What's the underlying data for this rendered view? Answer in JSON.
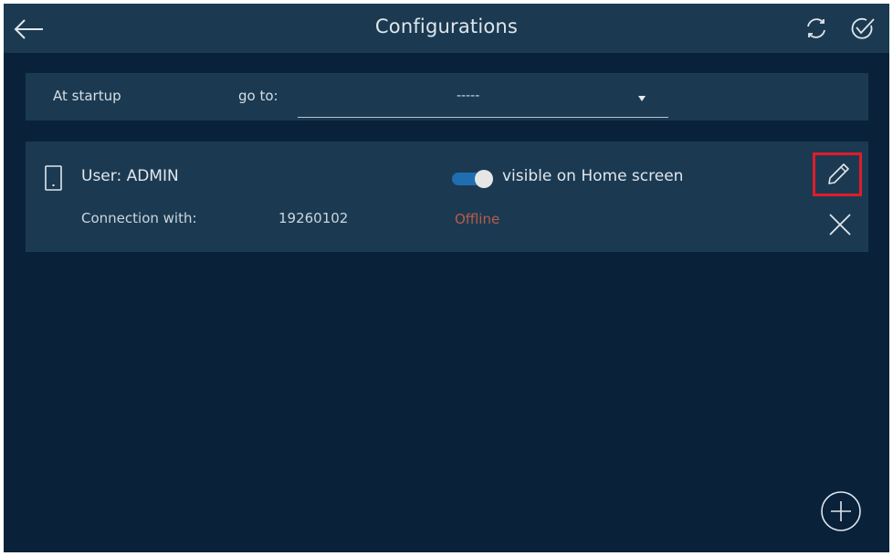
{
  "header": {
    "title": "Configurations",
    "back_icon": "arrow-left-icon",
    "refresh_icon": "refresh-icon",
    "confirm_icon": "check-circle-icon"
  },
  "startup": {
    "label": "At startup",
    "goto_label": "go to:",
    "select_value": "-----"
  },
  "user_card": {
    "device_icon": "phone-icon",
    "user_label": "User: ADMIN",
    "visible_toggle_on": true,
    "visible_label": "visible on Home screen",
    "connection_label": "Connection with:",
    "connection_value": "19260102",
    "status": "Offline",
    "edit_icon": "pencil-icon",
    "delete_icon": "close-icon"
  },
  "add_icon": "plus-circle-icon",
  "colors": {
    "background": "#09223a",
    "panel": "#1b3a52",
    "toggle_on": "#1f6fb0",
    "status_offline": "#b95b49",
    "highlight": "#e01c2a"
  }
}
